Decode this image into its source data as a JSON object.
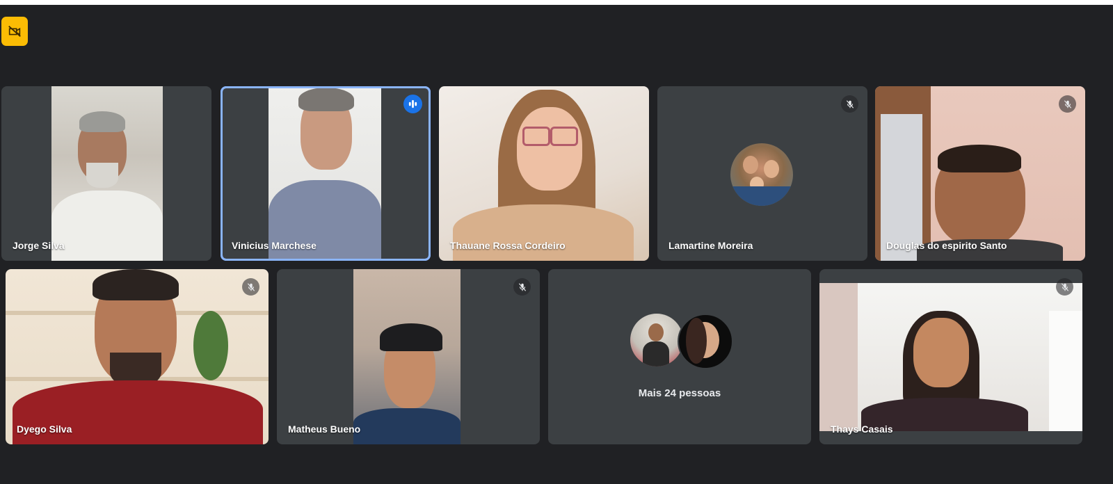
{
  "meeting": {
    "recording_icon": "no-video-badge-icon",
    "accent": "#8ab4f8",
    "tile_bg": "#3c4043",
    "page_bg": "#202124"
  },
  "participants": [
    {
      "name": "Jorge Silva",
      "muted": false,
      "speaking": false
    },
    {
      "name": "Vinicius Marchese",
      "muted": false,
      "speaking": true
    },
    {
      "name": "Thauane Rossa Cordeiro",
      "muted": false,
      "speaking": false
    },
    {
      "name": "Lamartine Moreira",
      "muted": true,
      "speaking": false
    },
    {
      "name": "Douglas do espirito Santo",
      "muted": true,
      "speaking": false
    },
    {
      "name": "Dyego Silva",
      "muted": true,
      "speaking": false
    },
    {
      "name": "Matheus Bueno",
      "muted": true,
      "speaking": false
    },
    {
      "name": "Thays Casais",
      "muted": true,
      "speaking": false
    }
  ],
  "overflow": {
    "label": "Mais 24 pessoas"
  }
}
